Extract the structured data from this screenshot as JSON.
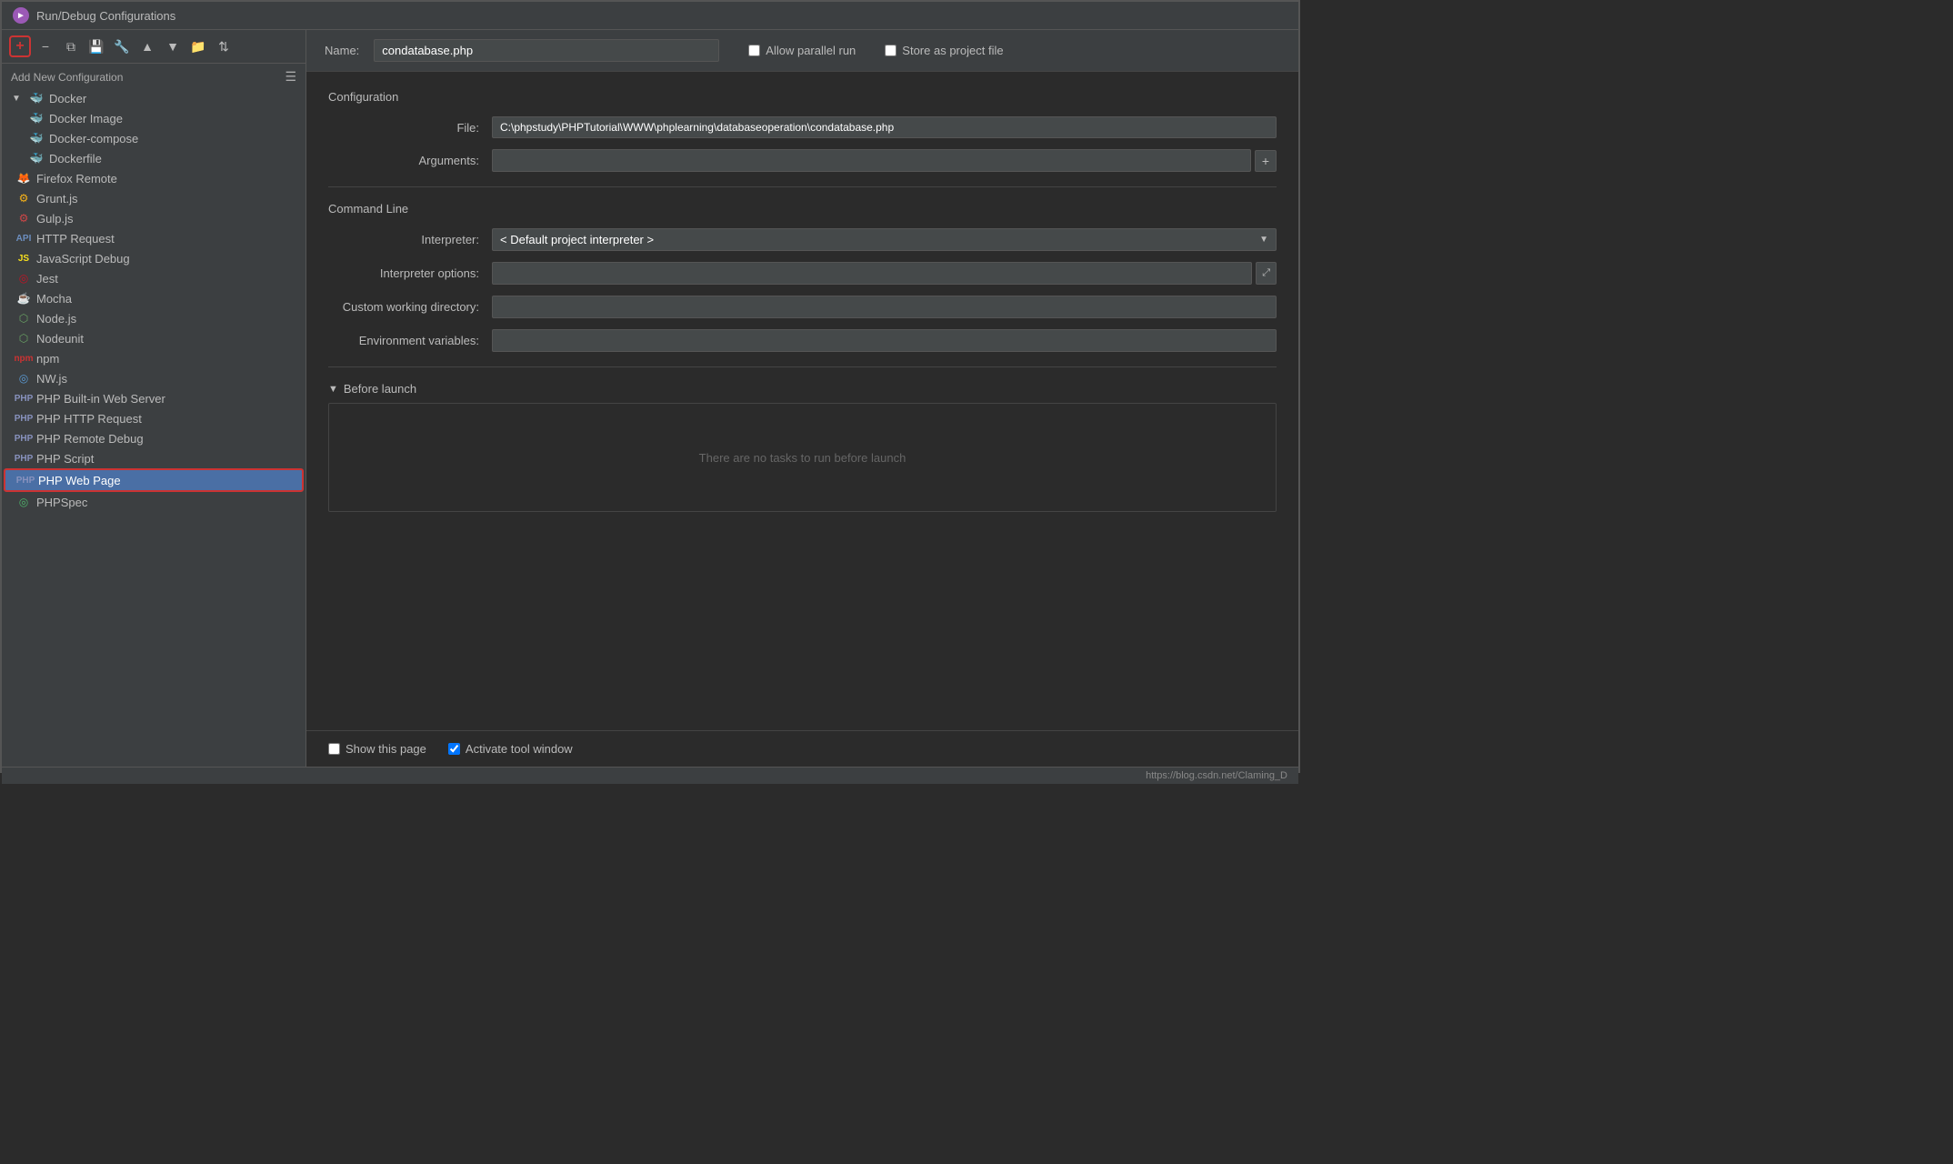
{
  "titleBar": {
    "icon": "►",
    "title": "Run/Debug Configurations"
  },
  "toolbar": {
    "add": "+",
    "remove": "−",
    "copy": "⧉",
    "save": "💾",
    "wrench": "🔧",
    "up": "▲",
    "down": "▼",
    "folder": "📁",
    "sort": "⇅"
  },
  "leftPanel": {
    "addNewConfig": "Add New Configuration",
    "treeItems": [
      {
        "id": "docker",
        "label": "Docker",
        "level": "parent",
        "icon": "docker",
        "hasChildren": true
      },
      {
        "id": "docker-image",
        "label": "Docker Image",
        "level": "child",
        "icon": "docker"
      },
      {
        "id": "docker-compose",
        "label": "Docker-compose",
        "level": "child",
        "icon": "docker"
      },
      {
        "id": "dockerfile",
        "label": "Dockerfile",
        "level": "child",
        "icon": "docker"
      },
      {
        "id": "firefox-remote",
        "label": "Firefox Remote",
        "level": "top",
        "icon": "firefox"
      },
      {
        "id": "grunt",
        "label": "Grunt.js",
        "level": "top",
        "icon": "grunt"
      },
      {
        "id": "gulp",
        "label": "Gulp.js",
        "level": "top",
        "icon": "gulp"
      },
      {
        "id": "http-request",
        "label": "HTTP Request",
        "level": "top",
        "icon": "http"
      },
      {
        "id": "js-debug",
        "label": "JavaScript Debug",
        "level": "top",
        "icon": "js"
      },
      {
        "id": "jest",
        "label": "Jest",
        "level": "top",
        "icon": "jest"
      },
      {
        "id": "mocha",
        "label": "Mocha",
        "level": "top",
        "icon": "mocha"
      },
      {
        "id": "nodejs",
        "label": "Node.js",
        "level": "top",
        "icon": "node"
      },
      {
        "id": "nodeunit",
        "label": "Nodeunit",
        "level": "top",
        "icon": "node"
      },
      {
        "id": "npm",
        "label": "npm",
        "level": "top",
        "icon": "npm"
      },
      {
        "id": "nwjs",
        "label": "NW.js",
        "level": "top",
        "icon": "nw"
      },
      {
        "id": "php-built-in",
        "label": "PHP Built-in Web Server",
        "level": "top",
        "icon": "php"
      },
      {
        "id": "php-http",
        "label": "PHP HTTP Request",
        "level": "top",
        "icon": "php"
      },
      {
        "id": "php-remote",
        "label": "PHP Remote Debug",
        "level": "top",
        "icon": "php"
      },
      {
        "id": "php-script",
        "label": "PHP Script",
        "level": "top",
        "icon": "php"
      },
      {
        "id": "php-webpage",
        "label": "PHP Web Page",
        "level": "top",
        "icon": "php",
        "selected": true
      },
      {
        "id": "phpspec",
        "label": "PHPSpec",
        "level": "top",
        "icon": "phpspec"
      }
    ]
  },
  "rightPanel": {
    "nameLabel": "Name:",
    "nameValue": "condatabase.php",
    "allowParallelRun": "Allow parallel run",
    "storeAsProjectFile": "Store as project file",
    "configurationTitle": "Configuration",
    "fileLabel": "File:",
    "fileValue": "C:\\phpstudy\\PHPTutorial\\WWW\\phplearning\\databaseoperation\\condatabase.php",
    "argumentsLabel": "Arguments:",
    "argumentsValue": "",
    "commandLineTitle": "Command Line",
    "interpreterLabel": "Interpreter:",
    "interpreterValue": "< Default project interpreter >",
    "interpreterOptionsLabel": "Interpreter options:",
    "interpreterOptionsValue": "",
    "customWorkingDirLabel": "Custom working directory:",
    "customWorkingDirValue": "",
    "envVarsLabel": "Environment variables:",
    "envVarsValue": "",
    "beforeLaunch": "Before launch",
    "noTasksText": "There are no tasks to run before launch",
    "showThisPage": "Show this page",
    "activateToolWindow": "Activate tool window",
    "showThisPageChecked": false,
    "activateToolWindowChecked": true
  },
  "statusBar": {
    "url": "https://blog.csdn.net/Claming_D"
  }
}
